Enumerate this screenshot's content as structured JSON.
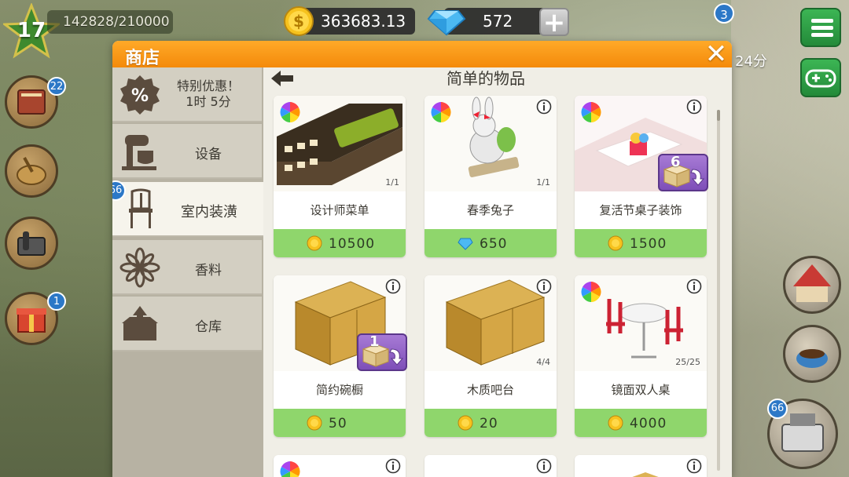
{
  "hud": {
    "level": "17",
    "xp": "142828/210000",
    "coins": "363683.13",
    "gems": "572",
    "plus": "+",
    "event_badge": "3",
    "event_timer": "24分"
  },
  "side_badges": {
    "book": "22",
    "gift": "1",
    "register": "66"
  },
  "shop": {
    "title": "商店",
    "close": "✕",
    "section_title": "简单的物品",
    "tabs": [
      {
        "label": "特别优惠！\n1时 5分",
        "line1": "特别优惠！",
        "line2": "1时 5分",
        "icon": "percent-icon"
      },
      {
        "label": "设备",
        "icon": "mixer-icon"
      },
      {
        "label": "室内装潢",
        "icon": "chair-icon",
        "badge": "66",
        "active": true
      },
      {
        "label": "香料",
        "icon": "spice-icon"
      },
      {
        "label": "仓库",
        "icon": "storage-box-icon"
      }
    ],
    "items": [
      {
        "name": "设计师菜单",
        "price": "10500",
        "currency": "coin",
        "stock": "1/1",
        "rainbow": true
      },
      {
        "name": "春季兔子",
        "price": "650",
        "currency": "gem",
        "stock": "1/1",
        "rainbow": true
      },
      {
        "name": "复活节桌子装饰",
        "price": "1500",
        "currency": "coin",
        "unlock": "6",
        "rainbow": true
      },
      {
        "name": "简约碗橱",
        "price": "50",
        "currency": "coin",
        "unlock": "1"
      },
      {
        "name": "木质吧台",
        "price": "20",
        "currency": "coin",
        "stock": "4/4"
      },
      {
        "name": "镜面双人桌",
        "price": "4000",
        "currency": "coin",
        "stock": "25/25",
        "rainbow": true
      }
    ]
  },
  "colors": {
    "header_orange": "#f79a16",
    "price_green": "#8fd66c",
    "badge_blue": "#2c78c7",
    "menu_green": "#2fa046"
  }
}
